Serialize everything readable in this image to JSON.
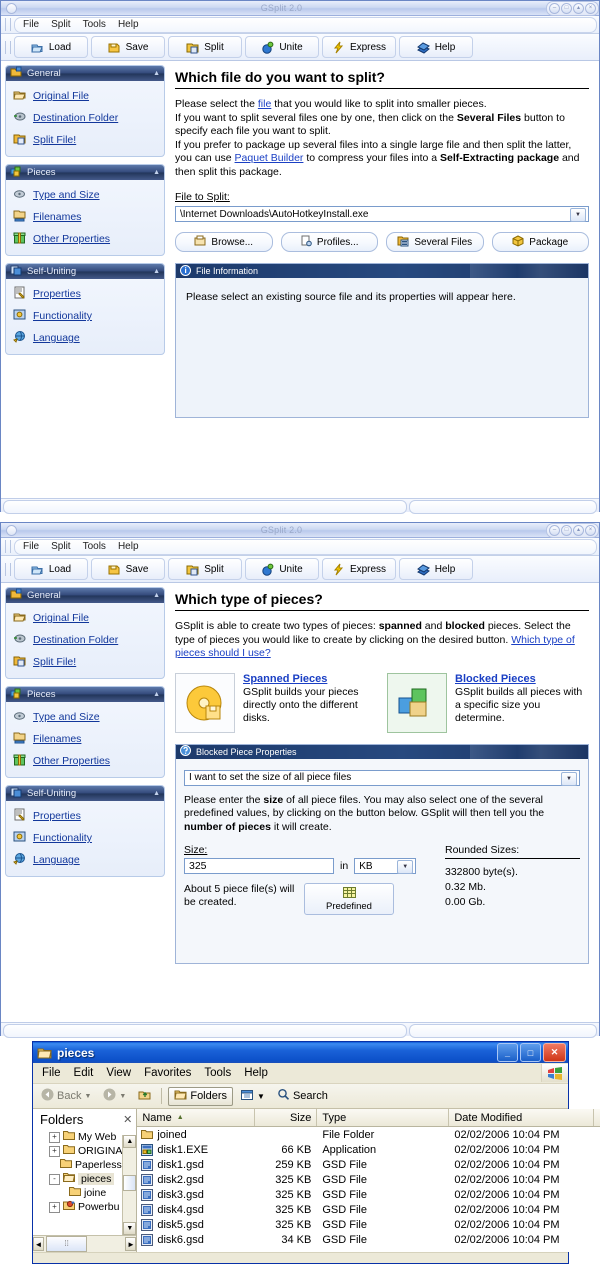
{
  "window1": {
    "title": "GSplit 2.0",
    "menu": [
      "File",
      "Split",
      "Tools",
      "Help"
    ],
    "toolbar": [
      {
        "label": "Load",
        "icon": "open-folder-icon"
      },
      {
        "label": "Save",
        "icon": "save-disk-icon"
      },
      {
        "label": "Split",
        "icon": "split-icon"
      },
      {
        "label": "Unite",
        "icon": "unite-icon"
      },
      {
        "label": "Express",
        "icon": "lightning-icon"
      },
      {
        "label": "Help",
        "icon": "help-book-icon"
      }
    ],
    "sidebar": [
      {
        "title": "General",
        "icon": "general-icon",
        "items": [
          {
            "label": "Original File",
            "icon": "file-open-icon"
          },
          {
            "label": "Destination Folder",
            "icon": "destination-icon"
          },
          {
            "label": "Split File!",
            "icon": "split-file-icon"
          }
        ]
      },
      {
        "title": "Pieces",
        "icon": "pieces-icon",
        "items": [
          {
            "label": "Type and Size",
            "icon": "type-size-icon"
          },
          {
            "label": "Filenames",
            "icon": "filenames-icon"
          },
          {
            "label": "Other Properties",
            "icon": "other-properties-icon"
          }
        ]
      },
      {
        "title": "Self-Uniting",
        "icon": "self-uniting-icon",
        "items": [
          {
            "label": "Properties",
            "icon": "properties-icon"
          },
          {
            "label": "Functionality",
            "icon": "functionality-icon"
          },
          {
            "label": "Language",
            "icon": "language-icon"
          }
        ]
      }
    ],
    "heading": "Which file do you want to split?",
    "para": {
      "p1a": "Please select the ",
      "p1link": "file",
      "p1b": " that you would like to split into smaller pieces.",
      "p2a": "If you want to split several files one by one, then click on the ",
      "p2b": "Several Files",
      "p2c": " button to specify each file you want to split.",
      "p3a": "If you prefer to package up several files into a single large file and then split the latter, you can use ",
      "p3link": "Paquet Builder",
      "p3b": " to compress your files into a ",
      "p3c": "Self-Extracting package",
      "p3d": " and then split this package."
    },
    "file_label": "File to Split:",
    "file_value": "\\Internet Downloads\\AutoHotkeyInstall.exe",
    "buttons": [
      {
        "label": "Browse...",
        "icon": "browse-icon"
      },
      {
        "label": "Profiles...",
        "icon": "profiles-icon"
      },
      {
        "label": "Several Files",
        "icon": "several-files-icon"
      },
      {
        "label": "Package",
        "icon": "package-icon"
      }
    ],
    "info_panel": {
      "title": "File Information",
      "icon": "info-icon",
      "text": "Please select an existing source file and its properties will appear here."
    }
  },
  "window2": {
    "title": "GSplit 2.0",
    "menu": [
      "File",
      "Split",
      "Tools",
      "Help"
    ],
    "toolbar": [
      {
        "label": "Load",
        "icon": "open-folder-icon"
      },
      {
        "label": "Save",
        "icon": "save-disk-icon"
      },
      {
        "label": "Split",
        "icon": "split-icon"
      },
      {
        "label": "Unite",
        "icon": "unite-icon"
      },
      {
        "label": "Express",
        "icon": "lightning-icon"
      },
      {
        "label": "Help",
        "icon": "help-book-icon"
      }
    ],
    "sidebar": [
      {
        "title": "General",
        "icon": "general-icon",
        "items": [
          {
            "label": "Original File",
            "icon": "file-open-icon"
          },
          {
            "label": "Destination Folder",
            "icon": "destination-icon"
          },
          {
            "label": "Split File!",
            "icon": "split-file-icon"
          }
        ]
      },
      {
        "title": "Pieces",
        "icon": "pieces-icon",
        "items": [
          {
            "label": "Type and Size",
            "icon": "type-size-icon"
          },
          {
            "label": "Filenames",
            "icon": "filenames-icon"
          },
          {
            "label": "Other Properties",
            "icon": "other-properties-icon"
          }
        ]
      },
      {
        "title": "Self-Uniting",
        "icon": "self-uniting-icon",
        "items": [
          {
            "label": "Properties",
            "icon": "properties-icon"
          },
          {
            "label": "Functionality",
            "icon": "functionality-icon"
          },
          {
            "label": "Language",
            "icon": "language-icon"
          }
        ]
      }
    ],
    "heading": "Which type of pieces?",
    "intro": {
      "a": "GSplit is able to create two types of pieces: ",
      "b": "spanned",
      "c": " and ",
      "d": "blocked",
      "e": " pieces. Select the type of pieces you would like to create by clicking on the desired button. ",
      "link": "Which type of pieces should I use?"
    },
    "choices": [
      {
        "title": "Spanned Pieces",
        "desc": "GSplit builds your pieces directly onto the different disks.",
        "icon": "spanned-disk-icon",
        "selected": false
      },
      {
        "title": "Blocked Pieces",
        "desc": "GSplit builds all pieces with a specific size you determine.",
        "icon": "blocked-cubes-icon",
        "selected": true
      }
    ],
    "props_panel": {
      "title": "Blocked Piece Properties",
      "icon": "help-globe-icon",
      "combo_value": "I want to set the size of all piece files",
      "desc": {
        "a": "Please enter the ",
        "b": "size",
        "c": " of all piece files. You may also select one of the several predefined values, by clicking on the button below. GSplit will then tell you the ",
        "d": "number of pieces",
        "e": " it will create."
      },
      "size_label": "Size:",
      "size_value": "325",
      "in_label": "in",
      "unit_value": "KB",
      "note": "About 5 piece file(s) will be created.",
      "predefined_label": "Predefined",
      "predefined_icon": "table-icon",
      "rounded_label": "Rounded Sizes:",
      "rounded_values": [
        "332800 byte(s).",
        "0.32 Mb.",
        "0.00 Gb."
      ]
    }
  },
  "explorer": {
    "title": "pieces",
    "title_icon": "folder-icon",
    "window_buttons": [
      "_",
      "□",
      "✕"
    ],
    "menu": [
      "File",
      "Edit",
      "View",
      "Favorites",
      "Tools",
      "Help"
    ],
    "toolbar": {
      "back": "Back",
      "folders": "Folders",
      "search": "Search",
      "back_icon": "back-arrow-icon",
      "forward_icon": "forward-arrow-icon",
      "up_icon": "up-folder-icon",
      "folders_icon": "folders-icon",
      "views_icon": "views-icon",
      "search_icon": "magnifier-icon"
    },
    "tree": {
      "header": "Folders",
      "close_icon": "close-icon",
      "nodes": [
        {
          "label": "My Web",
          "expander": "+",
          "indent": 12,
          "icon": "folder-icon",
          "selected": false
        },
        {
          "label": "ORIGINA",
          "expander": "+",
          "indent": 12,
          "icon": "folder-icon",
          "selected": false
        },
        {
          "label": "Paperless",
          "expander": "",
          "indent": 12,
          "icon": "folder-icon",
          "selected": false
        },
        {
          "label": "pieces",
          "expander": "-",
          "indent": 12,
          "icon": "folder-open-icon",
          "selected": true
        },
        {
          "label": "joine",
          "expander": "",
          "indent": 30,
          "icon": "folder-icon",
          "selected": false
        },
        {
          "label": "Powerbu",
          "expander": "+",
          "indent": 12,
          "icon": "powerbuilder-icon",
          "selected": false
        }
      ]
    },
    "list": {
      "columns": [
        "Name",
        "Size",
        "Type",
        "Date Modified"
      ],
      "sort_indicator": "▲",
      "rows": [
        {
          "name": "joined",
          "size": "",
          "type": "File Folder",
          "date": "02/02/2006 10:04 PM",
          "icon": "folder-icon"
        },
        {
          "name": "disk1.EXE",
          "size": "66 KB",
          "type": "Application",
          "date": "02/02/2006 10:04 PM",
          "icon": "exe-icon"
        },
        {
          "name": "disk1.gsd",
          "size": "259 KB",
          "type": "GSD File",
          "date": "02/02/2006 10:04 PM",
          "icon": "gsd-icon"
        },
        {
          "name": "disk2.gsd",
          "size": "325 KB",
          "type": "GSD File",
          "date": "02/02/2006 10:04 PM",
          "icon": "gsd-icon"
        },
        {
          "name": "disk3.gsd",
          "size": "325 KB",
          "type": "GSD File",
          "date": "02/02/2006 10:04 PM",
          "icon": "gsd-icon"
        },
        {
          "name": "disk4.gsd",
          "size": "325 KB",
          "type": "GSD File",
          "date": "02/02/2006 10:04 PM",
          "icon": "gsd-icon"
        },
        {
          "name": "disk5.gsd",
          "size": "325 KB",
          "type": "GSD File",
          "date": "02/02/2006 10:04 PM",
          "icon": "gsd-icon"
        },
        {
          "name": "disk6.gsd",
          "size": "34 KB",
          "type": "GSD File",
          "date": "02/02/2006 10:04 PM",
          "icon": "gsd-icon"
        }
      ]
    }
  },
  "colors": {
    "gsplit_header": "#27497f",
    "link": "#12379b",
    "explorer_title": "#0c50c9",
    "explorer_chrome": "#ece9d8"
  }
}
